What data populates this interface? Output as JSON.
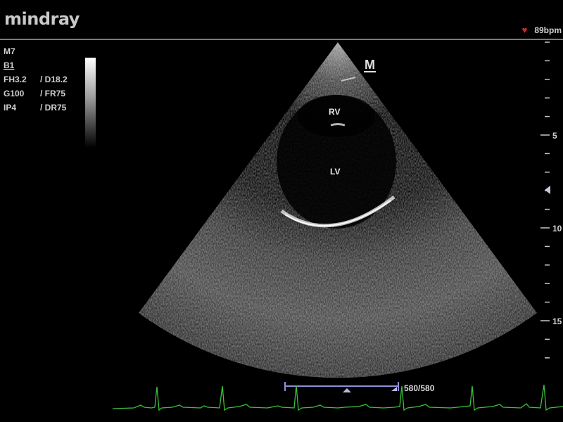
{
  "header": {
    "logo_text": "mindray",
    "heart_icon": "heart-icon",
    "heart_rate": "89bpm"
  },
  "params": {
    "mode": "M7",
    "preset": "B1",
    "rows": [
      {
        "left": "FH3.2",
        "right": "/ D18.2"
      },
      {
        "left": "G100",
        "right": "/ FR75"
      },
      {
        "left": "IP4",
        "right": "/ DR75"
      }
    ]
  },
  "image": {
    "mmode_marker": "M",
    "labels": {
      "rv": "RV",
      "lv": "LV"
    }
  },
  "depth_scale": {
    "labels": [
      "5",
      "10",
      "15"
    ],
    "focus_marker": "focus-triangle-icon"
  },
  "cine": {
    "counter": "580/580"
  },
  "colors": {
    "heart": "#e0242a",
    "ecg": "#3cc13c",
    "cine_bar": "#8f8fd8"
  }
}
